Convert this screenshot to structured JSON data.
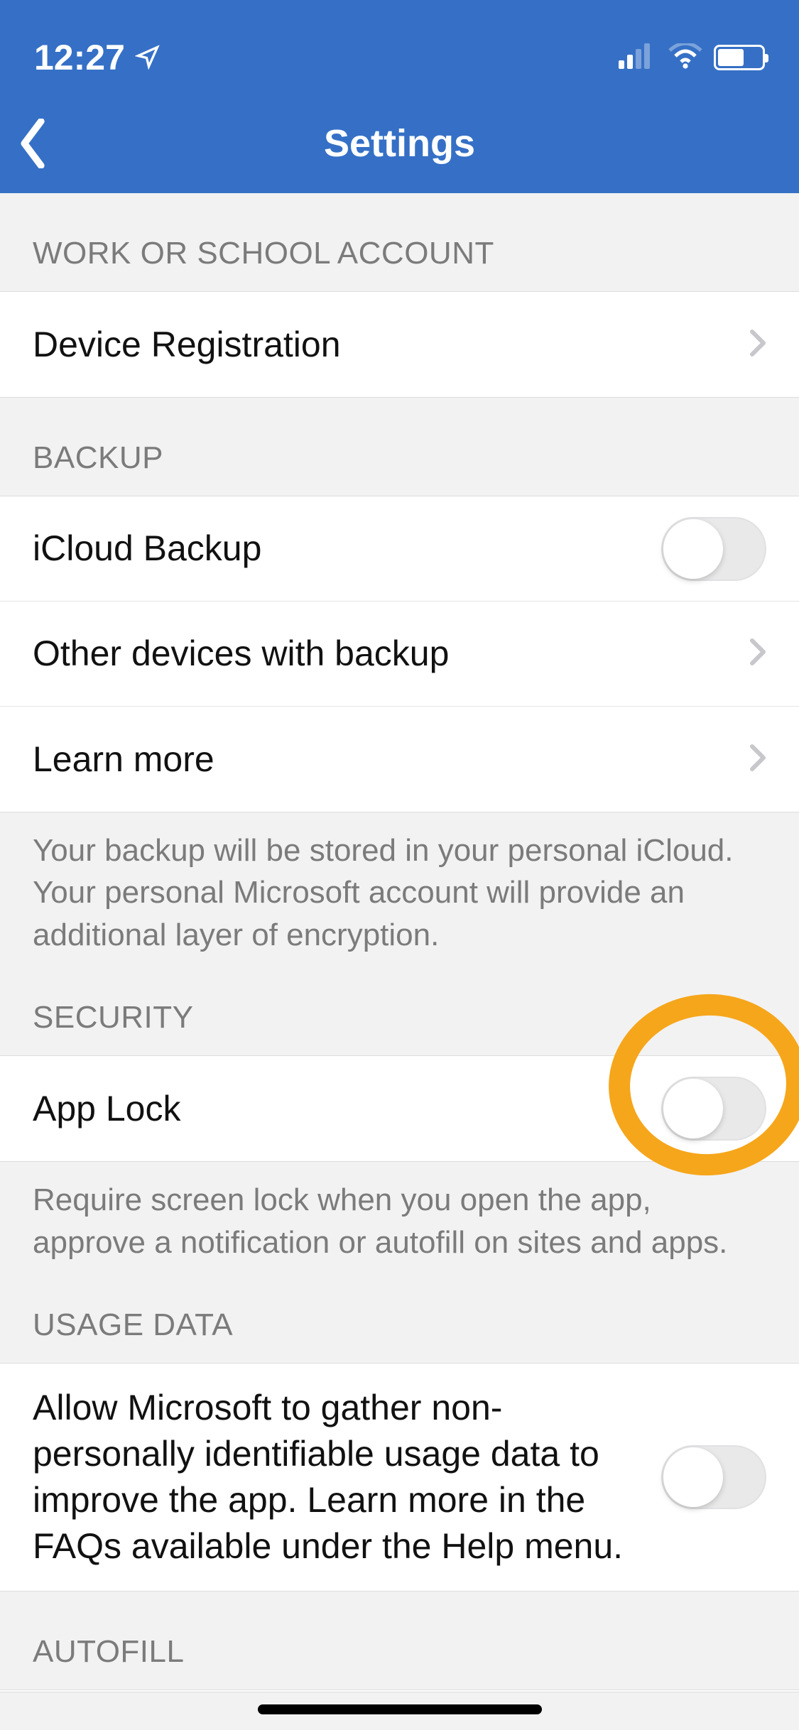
{
  "statusBar": {
    "time": "12:27"
  },
  "nav": {
    "title": "Settings"
  },
  "sections": {
    "workSchool": {
      "header": "WORK OR SCHOOL ACCOUNT",
      "deviceRegistration": "Device Registration"
    },
    "backup": {
      "header": "BACKUP",
      "icloudBackup": "iCloud Backup",
      "otherDevices": "Other devices with backup",
      "learnMore": "Learn more",
      "footer": "Your backup will be stored in your personal iCloud. Your personal Microsoft account will provide an additional layer of encryption."
    },
    "security": {
      "header": "SECURITY",
      "appLock": "App Lock",
      "footer": "Require screen lock when you open the app, approve a notification or autofill on sites and apps."
    },
    "usageData": {
      "header": "USAGE DATA",
      "label": "Allow Microsoft to gather non-personally identifiable usage data to improve the app. Learn more in the FAQs available under the Help menu."
    },
    "autofill": {
      "header": "AUTOFILL"
    }
  }
}
